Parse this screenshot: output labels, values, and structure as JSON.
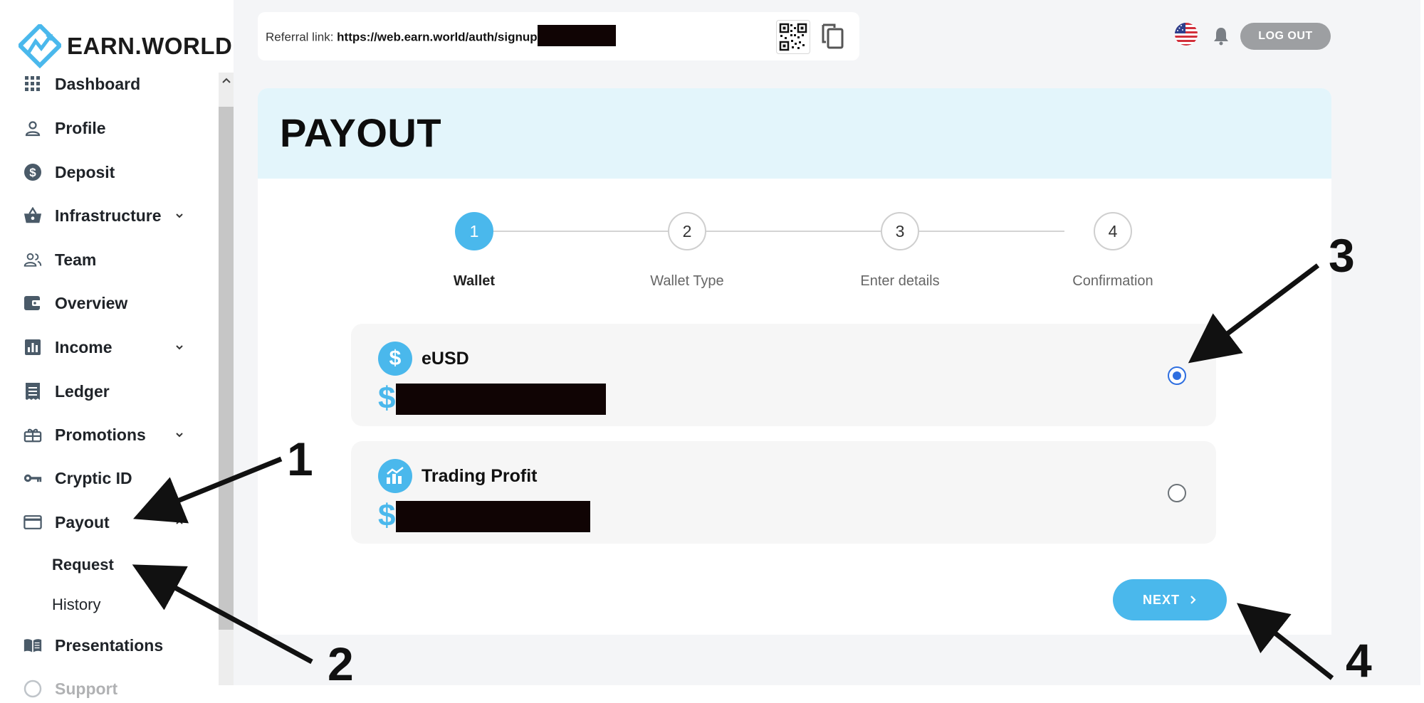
{
  "brand": {
    "name": "EARN.WORLD"
  },
  "sidebar": {
    "items": [
      {
        "label": "Dashboard",
        "icon": "grid-icon"
      },
      {
        "label": "Profile",
        "icon": "person-icon"
      },
      {
        "label": "Deposit",
        "icon": "dollar-circle-icon"
      },
      {
        "label": "Infrastructure",
        "icon": "basket-icon"
      },
      {
        "label": "Team",
        "icon": "people-icon"
      },
      {
        "label": "Overview",
        "icon": "wallet-icon"
      },
      {
        "label": "Income",
        "icon": "bar-chart-icon"
      },
      {
        "label": "Ledger",
        "icon": "receipt-icon"
      },
      {
        "label": "Promotions",
        "icon": "gift-icon"
      },
      {
        "label": "Cryptic ID",
        "icon": "key-icon"
      },
      {
        "label": "Payout",
        "icon": "credit-card-icon"
      },
      {
        "label": "Presentations",
        "icon": "book-icon"
      },
      {
        "label": "Support",
        "icon": "help-circle-icon"
      }
    ],
    "payout_sub": [
      {
        "label": "Request"
      },
      {
        "label": "History"
      }
    ]
  },
  "topbar": {
    "referral_label": "Referral link:",
    "referral_url": "https://web.earn.world/auth/signup",
    "logout_label": "LOG OUT"
  },
  "page": {
    "title": "PAYOUT"
  },
  "steps": [
    {
      "num": "1",
      "label": "Wallet",
      "active": true
    },
    {
      "num": "2",
      "label": "Wallet Type",
      "active": false
    },
    {
      "num": "3",
      "label": "Enter details",
      "active": false
    },
    {
      "num": "4",
      "label": "Confirmation",
      "active": false
    }
  ],
  "wallets": [
    {
      "name": "eUSD",
      "currency": "$",
      "selected": true,
      "icon": "dollar-icon"
    },
    {
      "name": "Trading Profit",
      "currency": "$",
      "selected": false,
      "icon": "chart-icon"
    }
  ],
  "next_label": "NEXT",
  "annotations": [
    "1",
    "2",
    "3",
    "4"
  ],
  "colors": {
    "accent": "#4ab8ec",
    "radio": "#2f6fe0",
    "header_bg": "#e3f5fb"
  }
}
